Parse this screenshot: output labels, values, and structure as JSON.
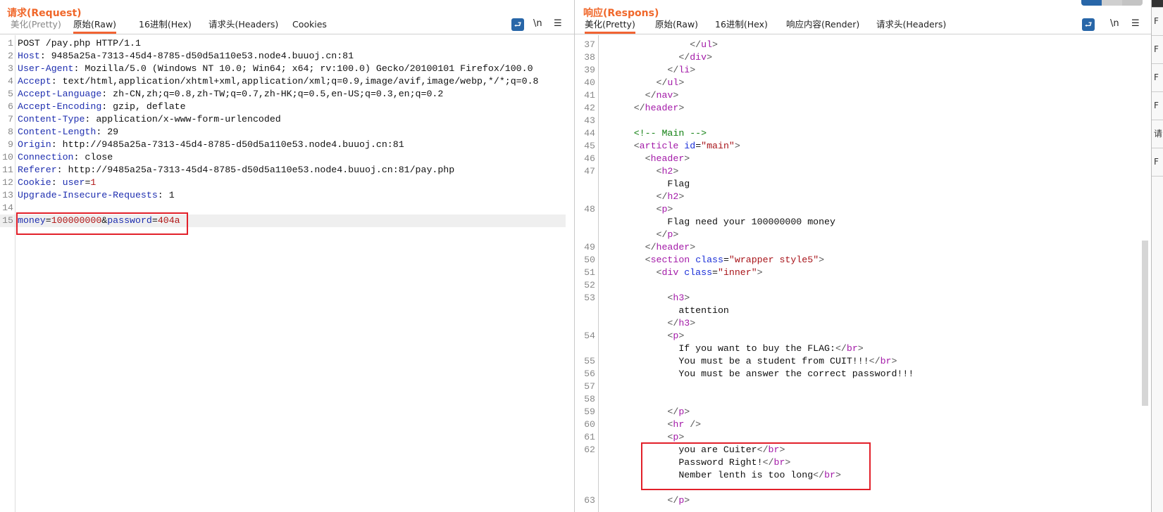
{
  "request": {
    "title": "请求(Request)",
    "tabs": [
      {
        "label": "美化(Pretty)",
        "state": "dim"
      },
      {
        "label": "原始(Raw)",
        "state": "active"
      },
      {
        "label": "16进制(Hex)",
        "state": ""
      },
      {
        "label": "请求头(Headers)",
        "state": ""
      },
      {
        "label": "Cookies",
        "state": ""
      }
    ],
    "tools": {
      "wrap": "wrap-lines-icon",
      "newline": "\\n",
      "menu": "☰"
    },
    "lines": [
      {
        "n": "1",
        "tokens": [
          [
            "POST /pay.php HTTP/1.1",
            "p"
          ]
        ]
      },
      {
        "n": "2",
        "tokens": [
          [
            "Host",
            "k"
          ],
          [
            ": 9485a25a-7313-45d4-8785-d50d5a110e53.node4.buuoj.cn:81",
            "p"
          ]
        ]
      },
      {
        "n": "3",
        "tokens": [
          [
            "User-Agent",
            "k"
          ],
          [
            ": Mozilla/5.0 (Windows NT 10.0; Win64; x64; rv:100.0) Gecko/20100101 Firefox/100.0",
            "p"
          ]
        ]
      },
      {
        "n": "4",
        "tokens": [
          [
            "Accept",
            "k"
          ],
          [
            ": text/html,application/xhtml+xml,application/xml;q=0.9,image/avif,image/webp,*/*;q=0.8",
            "p"
          ]
        ]
      },
      {
        "n": "5",
        "tokens": [
          [
            "Accept-Language",
            "k"
          ],
          [
            ": zh-CN,zh;q=0.8,zh-TW;q=0.7,zh-HK;q=0.5,en-US;q=0.3,en;q=0.2",
            "p"
          ]
        ]
      },
      {
        "n": "6",
        "tokens": [
          [
            "Accept-Encoding",
            "k"
          ],
          [
            ": gzip, deflate",
            "p"
          ]
        ]
      },
      {
        "n": "7",
        "tokens": [
          [
            "Content-Type",
            "k"
          ],
          [
            ": application/x-www-form-urlencoded",
            "p"
          ]
        ]
      },
      {
        "n": "8",
        "tokens": [
          [
            "Content-Length",
            "k"
          ],
          [
            ": 29",
            "p"
          ]
        ]
      },
      {
        "n": "9",
        "tokens": [
          [
            "Origin",
            "k"
          ],
          [
            ": http://9485a25a-7313-45d4-8785-d50d5a110e53.node4.buuoj.cn:81",
            "p"
          ]
        ]
      },
      {
        "n": "10",
        "tokens": [
          [
            "Connection",
            "k"
          ],
          [
            ": close",
            "p"
          ]
        ]
      },
      {
        "n": "11",
        "tokens": [
          [
            "Referer",
            "k"
          ],
          [
            ": http://9485a25a-7313-45d4-8785-d50d5a110e53.node4.buuoj.cn:81/pay.php",
            "p"
          ]
        ]
      },
      {
        "n": "12",
        "tokens": [
          [
            "Cookie",
            "k"
          ],
          [
            ": ",
            "p"
          ],
          [
            "user",
            "k"
          ],
          [
            "=",
            "p"
          ],
          [
            "1",
            "v"
          ]
        ]
      },
      {
        "n": "13",
        "tokens": [
          [
            "Upgrade-Insecure-Requests",
            "k"
          ],
          [
            ": 1",
            "p"
          ]
        ]
      },
      {
        "n": "14",
        "tokens": []
      },
      {
        "n": "15",
        "highlight": true,
        "tokens": [
          [
            "money",
            "k"
          ],
          [
            "=",
            "p"
          ],
          [
            "100000000",
            "v"
          ],
          [
            "&",
            "p"
          ],
          [
            "password",
            "k"
          ],
          [
            "=",
            "p"
          ],
          [
            "404a",
            "v"
          ]
        ]
      }
    ]
  },
  "response": {
    "title": "响应(Respons)",
    "tabs": [
      {
        "label": "美化(Pretty)",
        "state": "active"
      },
      {
        "label": "原始(Raw)",
        "state": ""
      },
      {
        "label": "16进制(Hex)",
        "state": ""
      },
      {
        "label": "响应内容(Render)",
        "state": ""
      },
      {
        "label": "请求头(Headers)",
        "state": ""
      }
    ],
    "tools": {
      "wrap": "wrap-lines-icon",
      "newline": "\\n",
      "menu": "☰"
    },
    "lines": [
      {
        "n": "",
        "tokens": [
          [
            "                  ",
            "p"
          ],
          [
            "</",
            "b"
          ],
          [
            "li",
            "g"
          ],
          [
            ">",
            "b"
          ]
        ]
      },
      {
        "n": "37",
        "tokens": [
          [
            "                ",
            "p"
          ],
          [
            "</",
            "b"
          ],
          [
            "ul",
            "g"
          ],
          [
            ">",
            "b"
          ]
        ]
      },
      {
        "n": "38",
        "tokens": [
          [
            "              ",
            "p"
          ],
          [
            "</",
            "b"
          ],
          [
            "div",
            "g"
          ],
          [
            ">",
            "b"
          ]
        ]
      },
      {
        "n": "39",
        "tokens": [
          [
            "            ",
            "p"
          ],
          [
            "</",
            "b"
          ],
          [
            "li",
            "g"
          ],
          [
            ">",
            "b"
          ]
        ]
      },
      {
        "n": "40",
        "tokens": [
          [
            "          ",
            "p"
          ],
          [
            "</",
            "b"
          ],
          [
            "ul",
            "g"
          ],
          [
            ">",
            "b"
          ]
        ]
      },
      {
        "n": "41",
        "tokens": [
          [
            "        ",
            "p"
          ],
          [
            "</",
            "b"
          ],
          [
            "nav",
            "g"
          ],
          [
            ">",
            "b"
          ]
        ]
      },
      {
        "n": "42",
        "tokens": [
          [
            "      ",
            "p"
          ],
          [
            "</",
            "b"
          ],
          [
            "header",
            "g"
          ],
          [
            ">",
            "b"
          ]
        ]
      },
      {
        "n": "43",
        "tokens": []
      },
      {
        "n": "44",
        "tokens": [
          [
            "      ",
            "p"
          ],
          [
            "<!-- Main -->",
            "c"
          ]
        ]
      },
      {
        "n": "45",
        "tokens": [
          [
            "      ",
            "p"
          ],
          [
            "<",
            "b"
          ],
          [
            "article",
            "g"
          ],
          [
            " ",
            "p"
          ],
          [
            "id",
            "a"
          ],
          [
            "=",
            "p"
          ],
          [
            "\"main\"",
            "s"
          ],
          [
            ">",
            "b"
          ]
        ]
      },
      {
        "n": "46",
        "tokens": [
          [
            "        ",
            "p"
          ],
          [
            "<",
            "b"
          ],
          [
            "header",
            "g"
          ],
          [
            ">",
            "b"
          ]
        ]
      },
      {
        "n": "47",
        "tokens": [
          [
            "          ",
            "p"
          ],
          [
            "<",
            "b"
          ],
          [
            "h2",
            "g"
          ],
          [
            ">",
            "b"
          ]
        ]
      },
      {
        "n": "",
        "tokens": [
          [
            "            Flag",
            "p"
          ]
        ]
      },
      {
        "n": "",
        "tokens": [
          [
            "          ",
            "p"
          ],
          [
            "</",
            "b"
          ],
          [
            "h2",
            "g"
          ],
          [
            ">",
            "b"
          ]
        ]
      },
      {
        "n": "48",
        "tokens": [
          [
            "          ",
            "p"
          ],
          [
            "<",
            "b"
          ],
          [
            "p",
            "g"
          ],
          [
            ">",
            "b"
          ]
        ]
      },
      {
        "n": "",
        "tokens": [
          [
            "            Flag need your 100000000 money",
            "p"
          ]
        ]
      },
      {
        "n": "",
        "tokens": [
          [
            "          ",
            "p"
          ],
          [
            "</",
            "b"
          ],
          [
            "p",
            "g"
          ],
          [
            ">",
            "b"
          ]
        ]
      },
      {
        "n": "49",
        "tokens": [
          [
            "        ",
            "p"
          ],
          [
            "</",
            "b"
          ],
          [
            "header",
            "g"
          ],
          [
            ">",
            "b"
          ]
        ]
      },
      {
        "n": "50",
        "tokens": [
          [
            "        ",
            "p"
          ],
          [
            "<",
            "b"
          ],
          [
            "section",
            "g"
          ],
          [
            " ",
            "p"
          ],
          [
            "class",
            "a"
          ],
          [
            "=",
            "p"
          ],
          [
            "\"wrapper style5\"",
            "s"
          ],
          [
            ">",
            "b"
          ]
        ]
      },
      {
        "n": "51",
        "tokens": [
          [
            "          ",
            "p"
          ],
          [
            "<",
            "b"
          ],
          [
            "div",
            "g"
          ],
          [
            " ",
            "p"
          ],
          [
            "class",
            "a"
          ],
          [
            "=",
            "p"
          ],
          [
            "\"inner\"",
            "s"
          ],
          [
            ">",
            "b"
          ]
        ]
      },
      {
        "n": "52",
        "tokens": []
      },
      {
        "n": "53",
        "tokens": [
          [
            "            ",
            "p"
          ],
          [
            "<",
            "b"
          ],
          [
            "h3",
            "g"
          ],
          [
            ">",
            "b"
          ]
        ]
      },
      {
        "n": "",
        "tokens": [
          [
            "              attention",
            "p"
          ]
        ]
      },
      {
        "n": "",
        "tokens": [
          [
            "            ",
            "p"
          ],
          [
            "</",
            "b"
          ],
          [
            "h3",
            "g"
          ],
          [
            ">",
            "b"
          ]
        ]
      },
      {
        "n": "54",
        "tokens": [
          [
            "            ",
            "p"
          ],
          [
            "<",
            "b"
          ],
          [
            "p",
            "g"
          ],
          [
            ">",
            "b"
          ]
        ]
      },
      {
        "n": "",
        "tokens": [
          [
            "              If you want to buy the FLAG:",
            "p"
          ],
          [
            "</",
            "b"
          ],
          [
            "br",
            "g"
          ],
          [
            ">",
            "b"
          ]
        ]
      },
      {
        "n": "55",
        "tokens": [
          [
            "              You must be a student from CUIT!!!",
            "p"
          ],
          [
            "</",
            "b"
          ],
          [
            "br",
            "g"
          ],
          [
            ">",
            "b"
          ]
        ]
      },
      {
        "n": "56",
        "tokens": [
          [
            "              You must be answer the correct password!!!",
            "p"
          ]
        ]
      },
      {
        "n": "57",
        "tokens": []
      },
      {
        "n": "58",
        "tokens": []
      },
      {
        "n": "59",
        "tokens": [
          [
            "            ",
            "p"
          ],
          [
            "</",
            "b"
          ],
          [
            "p",
            "g"
          ],
          [
            ">",
            "b"
          ]
        ]
      },
      {
        "n": "60",
        "tokens": [
          [
            "            ",
            "p"
          ],
          [
            "<",
            "b"
          ],
          [
            "hr",
            "g"
          ],
          [
            " />",
            "b"
          ]
        ]
      },
      {
        "n": "61",
        "tokens": [
          [
            "            ",
            "p"
          ],
          [
            "<",
            "b"
          ],
          [
            "p",
            "g"
          ],
          [
            ">",
            "b"
          ]
        ]
      },
      {
        "n": "62",
        "tokens": [
          [
            "              you are Cuiter",
            "p"
          ],
          [
            "</",
            "b"
          ],
          [
            "br",
            "g"
          ],
          [
            ">",
            "b"
          ]
        ]
      },
      {
        "n": "",
        "tokens": [
          [
            "              Password Right!",
            "p"
          ],
          [
            "</",
            "b"
          ],
          [
            "br",
            "g"
          ],
          [
            ">",
            "b"
          ]
        ]
      },
      {
        "n": "",
        "tokens": [
          [
            "              Nember lenth is too long",
            "p"
          ],
          [
            "</",
            "b"
          ],
          [
            "br",
            "g"
          ],
          [
            ">",
            "b"
          ]
        ]
      },
      {
        "n": "",
        "tokens": []
      },
      {
        "n": "63",
        "tokens": [
          [
            "            ",
            "p"
          ],
          [
            "</",
            "b"
          ],
          [
            "p",
            "g"
          ],
          [
            ">",
            "b"
          ]
        ]
      }
    ]
  },
  "sidebar": {
    "items": [
      "F",
      "F",
      "F",
      "F",
      "请",
      "F"
    ]
  },
  "colors": {
    "accent": "#f26433",
    "title": "#f0672a",
    "highlight_box": "#e2202a",
    "wrap_button": "#2866a8"
  }
}
